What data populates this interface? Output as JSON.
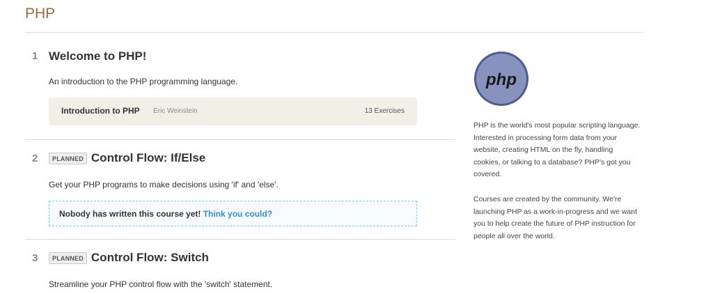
{
  "page": {
    "title": "PHP"
  },
  "sections": [
    {
      "number": "1",
      "title": "Welcome to PHP!",
      "description": "An introduction to the PHP programming language.",
      "course": {
        "name": "Introduction to PHP",
        "author": "Eric Weinstein",
        "exercises": "13 Exercises"
      }
    },
    {
      "number": "2",
      "badge": "PLANNED",
      "title": "Control Flow: If/Else",
      "description": "Get your PHP programs to make decisions using 'if' and 'else'.",
      "empty_text": "Nobody has written this course yet!",
      "empty_link": "Think you could?"
    },
    {
      "number": "3",
      "badge": "PLANNED",
      "title": "Control Flow: Switch",
      "description": "Streamline your PHP control flow with the 'switch' statement."
    }
  ],
  "sidebar": {
    "logo_text": "php",
    "paragraph1": "PHP is the world's most popular scripting language. Interested in processing form data from your website, creating HTML on the fly, handling cookies, or talking to a database? PHP's got you covered.",
    "paragraph2": "Courses are created by the community. We're launching PHP as a work-in-progress and we want you to help create the future of PHP instruction for people all over the world."
  },
  "colors": {
    "title": "#a06a3c",
    "link": "#2f8fc2",
    "card_bg": "#f2efe6",
    "logo": "#8892bf"
  }
}
